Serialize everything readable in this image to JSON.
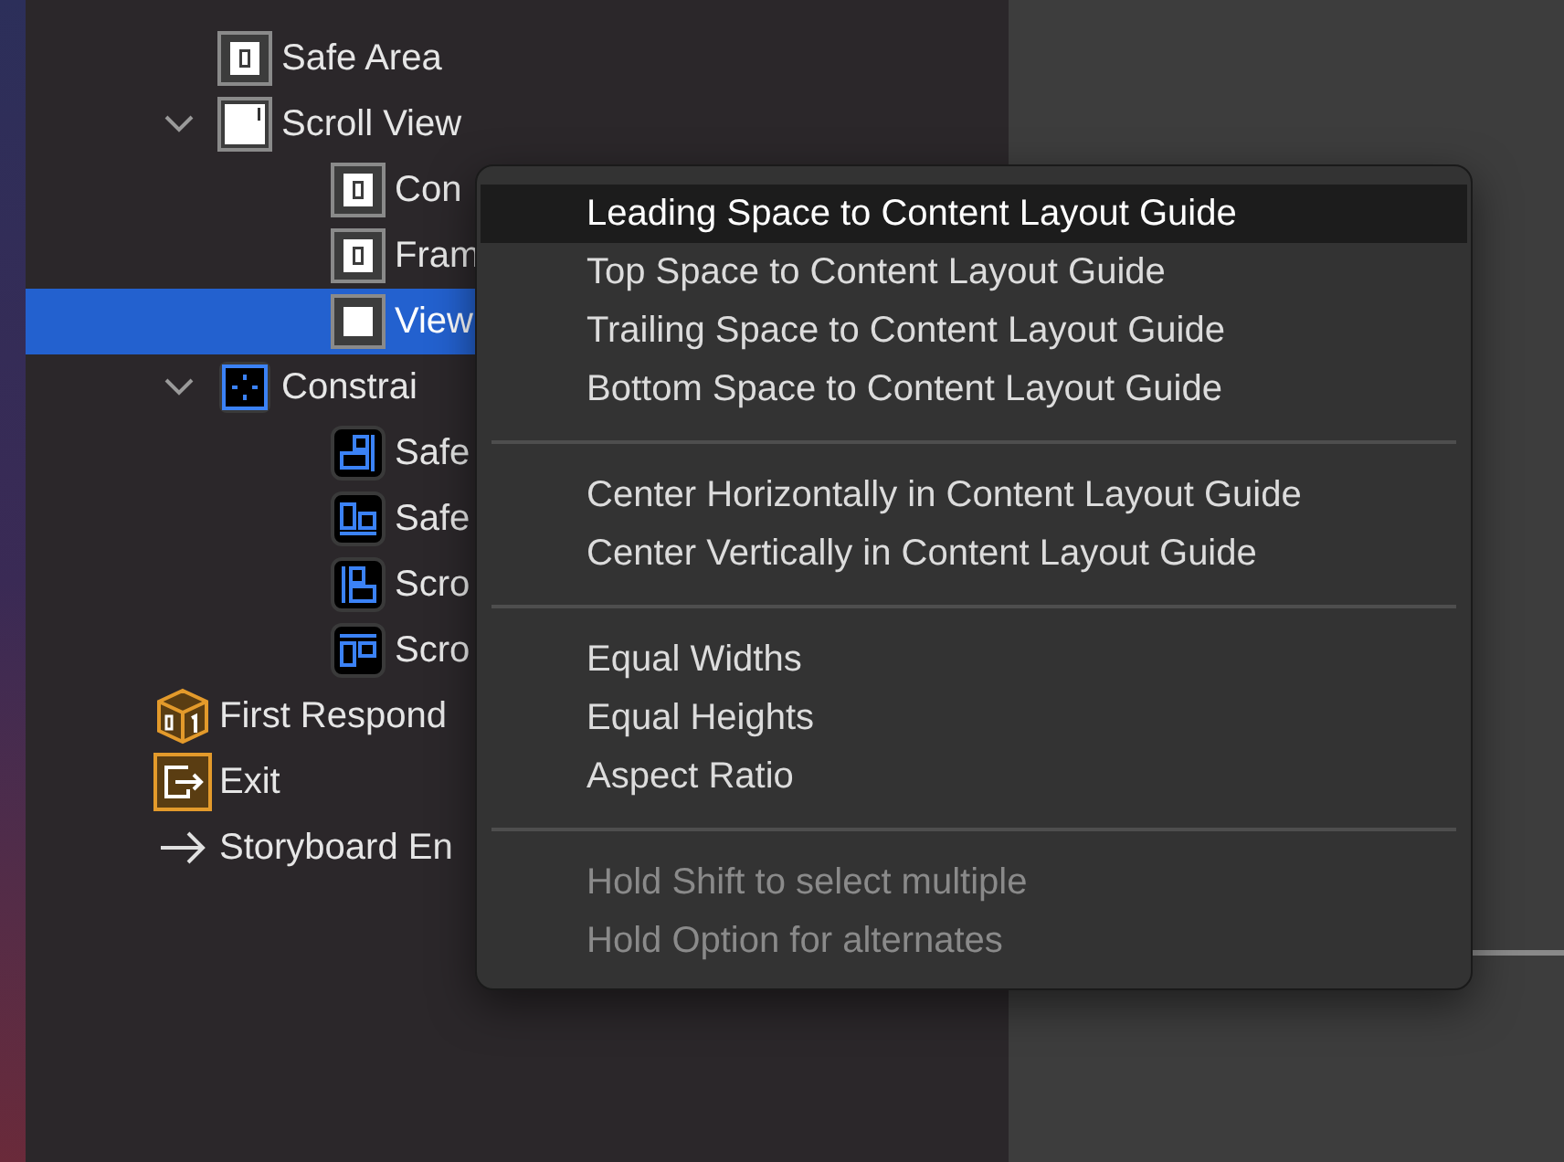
{
  "outline": {
    "view_children": [
      {
        "label": "Safe Area",
        "kind": "guide",
        "selected": false
      },
      {
        "label": "Scroll View",
        "kind": "scroll",
        "selected": false,
        "expanded": true,
        "children": [
          {
            "label": "Con",
            "kind": "guide",
            "selected": false
          },
          {
            "label": "Fram",
            "kind": "guide",
            "selected": false
          },
          {
            "label": "View",
            "kind": "view",
            "selected": true
          }
        ]
      },
      {
        "label": "Constrai",
        "kind": "constraints",
        "selected": false,
        "expanded": true,
        "children": [
          {
            "label": "Safe",
            "kind": "c-trailing",
            "selected": false
          },
          {
            "label": "Safe",
            "kind": "c-bottom",
            "selected": false
          },
          {
            "label": "Scro",
            "kind": "c-leading",
            "selected": false
          },
          {
            "label": "Scro",
            "kind": "c-top",
            "selected": false
          }
        ]
      }
    ],
    "scene_items": [
      {
        "label": "First Respond",
        "kind": "cube",
        "selected": false
      },
      {
        "label": "Exit",
        "kind": "exit",
        "selected": false
      },
      {
        "label": "Storyboard En",
        "kind": "entry",
        "selected": false
      }
    ]
  },
  "menu": {
    "groups": [
      {
        "items": [
          {
            "label": "Leading Space to Content Layout Guide",
            "selected": true,
            "disabled": false
          },
          {
            "label": "Top Space to Content Layout Guide",
            "selected": false,
            "disabled": false
          },
          {
            "label": "Trailing Space to Content Layout Guide",
            "selected": false,
            "disabled": false
          },
          {
            "label": "Bottom Space to Content Layout Guide",
            "selected": false,
            "disabled": false
          }
        ]
      },
      {
        "items": [
          {
            "label": "Center Horizontally in Content Layout Guide",
            "selected": false,
            "disabled": false
          },
          {
            "label": "Center Vertically in Content Layout Guide",
            "selected": false,
            "disabled": false
          }
        ]
      },
      {
        "items": [
          {
            "label": "Equal Widths",
            "selected": false,
            "disabled": false
          },
          {
            "label": "Equal Heights",
            "selected": false,
            "disabled": false
          },
          {
            "label": "Aspect Ratio",
            "selected": false,
            "disabled": false
          }
        ]
      },
      {
        "items": [
          {
            "label": "Hold Shift to select multiple",
            "selected": false,
            "disabled": true
          },
          {
            "label": "Hold Option for alternates",
            "selected": false,
            "disabled": true
          }
        ]
      }
    ]
  }
}
